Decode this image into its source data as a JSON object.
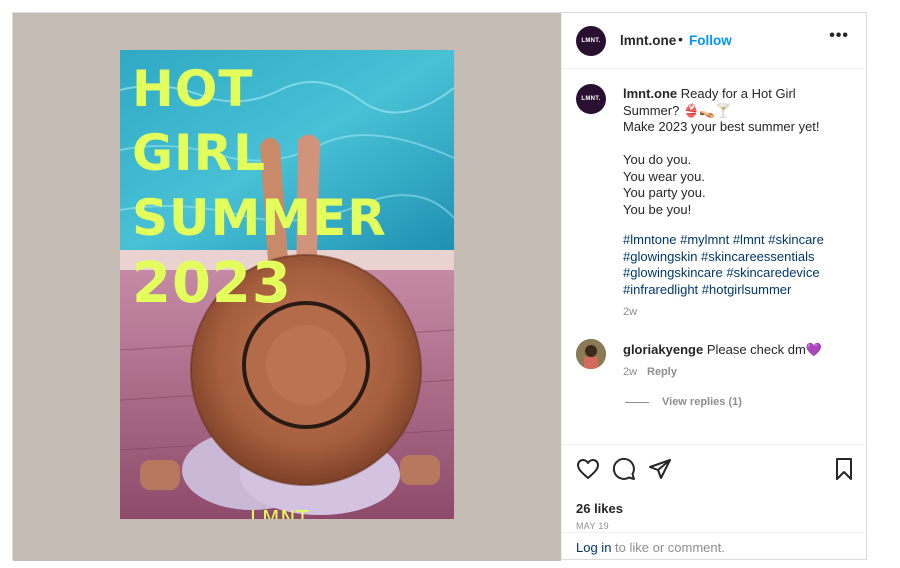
{
  "post": {
    "username": "lmnt.one",
    "avatar_text": "LMNT.",
    "follow_label": "Follow",
    "dot": "•",
    "more_label": "•••",
    "poster": {
      "line1": "HOT",
      "line2": "GIRL",
      "line3": "SUMMER",
      "line4": "2023",
      "brand": "LMNT."
    },
    "caption": {
      "username": "lmnt.one",
      "text": " Ready for a Hot Girl Summer? 👙👡🍸\nMake 2023 your best summer yet!\n\nYou do you.\nYou wear you.\nYou party you.\nYou be you!",
      "hashtags": "#lmntone #mylmnt #lmnt #skincare #glowingskin #skincareessentials #glowingskincare #skincaredevice #infraredlight #hotgirlsummer",
      "time": "2w"
    },
    "comment": {
      "username": "gloriakyenge",
      "text": " Please check dm💜",
      "time": "2w",
      "reply_label": "Reply",
      "view_replies": "View replies (1)"
    },
    "likes": "26 likes",
    "date": "MAY 19",
    "login_link": "Log in",
    "login_text": " to like or comment."
  },
  "colors": {
    "accent": "#0095f6",
    "poster_text": "#e2ff5b",
    "pane_bg": "#c3bbb4"
  },
  "icons": [
    "heart-icon",
    "comment-icon",
    "share-icon",
    "bookmark-icon",
    "more-icon"
  ]
}
